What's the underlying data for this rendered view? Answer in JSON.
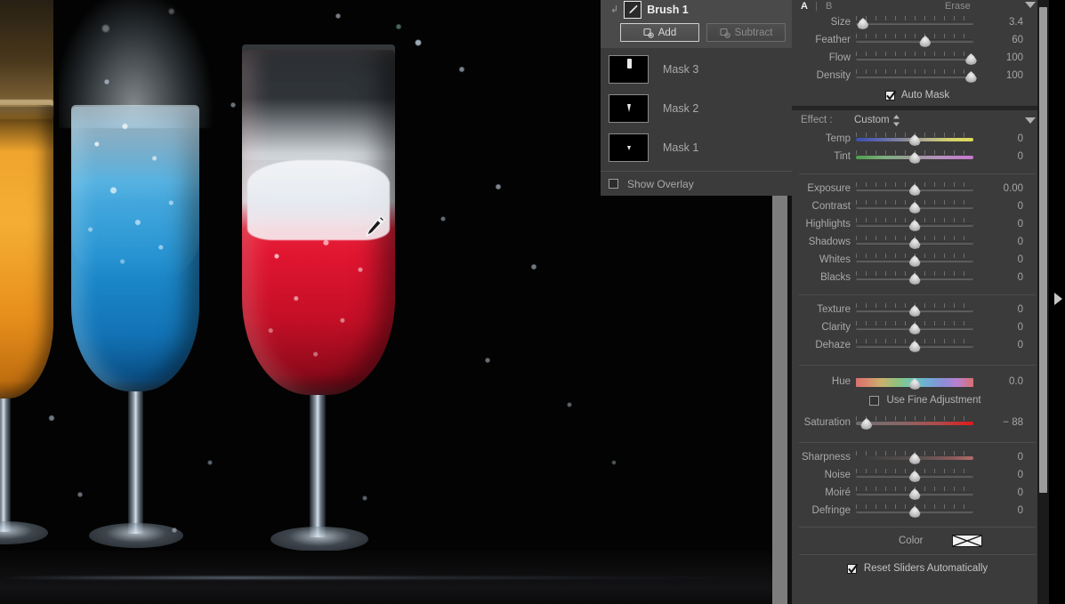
{
  "mask_panel": {
    "brush_arrow_icon": "arrow-return-icon",
    "brush_icon": "brush-icon",
    "brush_name": "Brush 1",
    "add_label": "Add",
    "subtract_label": "Subtract",
    "masks": [
      {
        "label": "Mask 3"
      },
      {
        "label": "Mask 2"
      },
      {
        "label": "Mask 1"
      }
    ],
    "show_overlay_label": "Show Overlay",
    "show_overlay_checked": false,
    "overlay_color": "#12e012",
    "more_dots": "•••"
  },
  "brush_settings": {
    "a_label": "A",
    "separator": "|",
    "b_label": "B",
    "erase_label": "Erase",
    "sliders": [
      {
        "label": "Size",
        "value": "3.4",
        "pos": 6
      },
      {
        "label": "Feather",
        "value": "60",
        "pos": 59
      },
      {
        "label": "Flow",
        "value": "100",
        "pos": 98
      },
      {
        "label": "Density",
        "value": "100",
        "pos": 98
      }
    ],
    "auto_mask_label": "Auto Mask",
    "auto_mask_checked": true
  },
  "effect": {
    "effect_label": "Effect :",
    "effect_value": "Custom",
    "white_balance": [
      {
        "label": "Temp",
        "value": "0",
        "pos": 50,
        "track": "t-temp"
      },
      {
        "label": "Tint",
        "value": "0",
        "pos": 50,
        "track": "t-tint"
      }
    ],
    "tone": [
      {
        "label": "Exposure",
        "value": "0.00",
        "pos": 50
      },
      {
        "label": "Contrast",
        "value": "0",
        "pos": 50
      },
      {
        "label": "Highlights",
        "value": "0",
        "pos": 50
      },
      {
        "label": "Shadows",
        "value": "0",
        "pos": 50
      },
      {
        "label": "Whites",
        "value": "0",
        "pos": 50
      },
      {
        "label": "Blacks",
        "value": "0",
        "pos": 50
      }
    ],
    "presence": [
      {
        "label": "Texture",
        "value": "0",
        "pos": 50
      },
      {
        "label": "Clarity",
        "value": "0",
        "pos": 50
      },
      {
        "label": "Dehaze",
        "value": "0",
        "pos": 50
      }
    ],
    "hue": {
      "label": "Hue",
      "value": "0.0",
      "pos": 50,
      "track": "t-hue"
    },
    "fine_adjustment_label": "Use Fine Adjustment",
    "fine_adjustment_checked": false,
    "saturation": {
      "label": "Saturation",
      "value": "− 88",
      "pos": 9,
      "track": "t-sat"
    },
    "detail": [
      {
        "label": "Sharpness",
        "value": "0",
        "pos": 50,
        "track": "t-sharp"
      },
      {
        "label": "Noise",
        "value": "0",
        "pos": 50
      },
      {
        "label": "Moiré",
        "value": "0",
        "pos": 50
      },
      {
        "label": "Defringe",
        "value": "0",
        "pos": 50
      }
    ],
    "color_label": "Color",
    "color_swatch_state": "none",
    "reset_sliders_label": "Reset Sliders Automatically",
    "reset_sliders_checked": true
  },
  "canvas": {
    "cursor_icon": "brush-cursor-icon",
    "expand_arrow_icon": "expand-right-arrow-icon"
  }
}
